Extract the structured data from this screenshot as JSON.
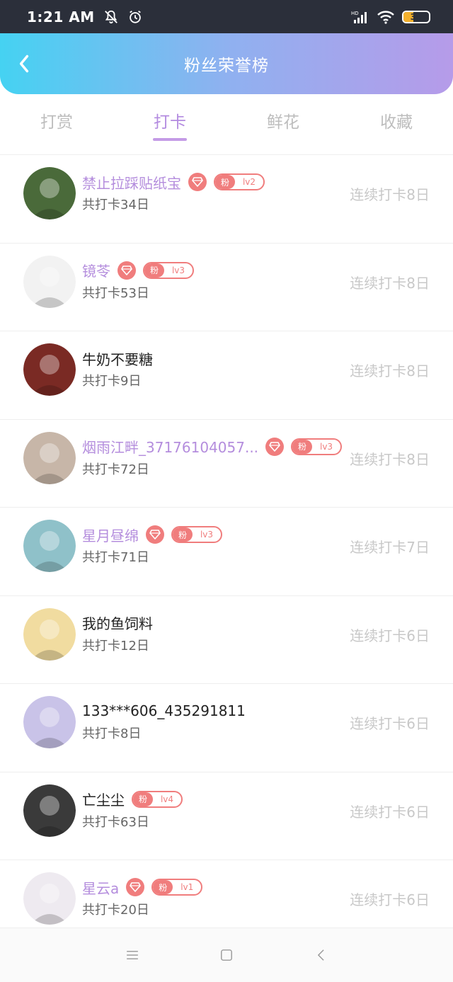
{
  "status": {
    "time": "1:21 AM",
    "battery": "39",
    "battery_level": 0.39
  },
  "header": {
    "title": "粉丝荣誉榜"
  },
  "tabs": [
    {
      "label": "打赏"
    },
    {
      "label": "打卡"
    },
    {
      "label": "鲜花"
    },
    {
      "label": "收藏"
    }
  ],
  "active_tab": 1,
  "users": [
    {
      "name": "禁止拉踩贴纸宝",
      "total": "共打卡34日",
      "streak": "连续打卡8日",
      "vip": true,
      "fan_tag": "粉",
      "level": "lv2",
      "avatar_color": "#4a6a3a"
    },
    {
      "name": "镜苓",
      "total": "共打卡53日",
      "streak": "连续打卡8日",
      "vip": true,
      "fan_tag": "粉",
      "level": "lv3",
      "avatar_color": "#f2f2f2"
    },
    {
      "name": "牛奶不要糖",
      "total": "共打卡9日",
      "streak": "连续打卡8日",
      "vip": false,
      "fan_tag": "",
      "level": "",
      "avatar_color": "#7a2a24"
    },
    {
      "name": "烟雨江畔_37176104057...",
      "total": "共打卡72日",
      "streak": "连续打卡8日",
      "vip": true,
      "fan_tag": "粉",
      "level": "lv3",
      "avatar_color": "#c7b6a8"
    },
    {
      "name": "星月昼绵",
      "total": "共打卡71日",
      "streak": "连续打卡7日",
      "vip": true,
      "fan_tag": "粉",
      "level": "lv3",
      "avatar_color": "#8fc1c9"
    },
    {
      "name": "我的鱼饲料",
      "total": "共打卡12日",
      "streak": "连续打卡6日",
      "vip": false,
      "fan_tag": "",
      "level": "",
      "avatar_color": "#f1dca0"
    },
    {
      "name": "133***606_435291811",
      "total": "共打卡8日",
      "streak": "连续打卡6日",
      "vip": false,
      "fan_tag": "",
      "level": "",
      "avatar_color": "#c9c3e8"
    },
    {
      "name": "亡尘尘",
      "total": "共打卡63日",
      "streak": "连续打卡6日",
      "vip": false,
      "fan_tag": "粉",
      "level": "lv4",
      "avatar_color": "#3a3a3a"
    },
    {
      "name": "星云a",
      "total": "共打卡20日",
      "streak": "连续打卡6日",
      "vip": true,
      "fan_tag": "粉",
      "level": "lv1",
      "avatar_color": "#eeeaf0"
    }
  ],
  "colors": {
    "accent": "#b38be0",
    "badge": "#f07d7d",
    "header_start": "#45d2f2",
    "header_end": "#b69be9"
  }
}
